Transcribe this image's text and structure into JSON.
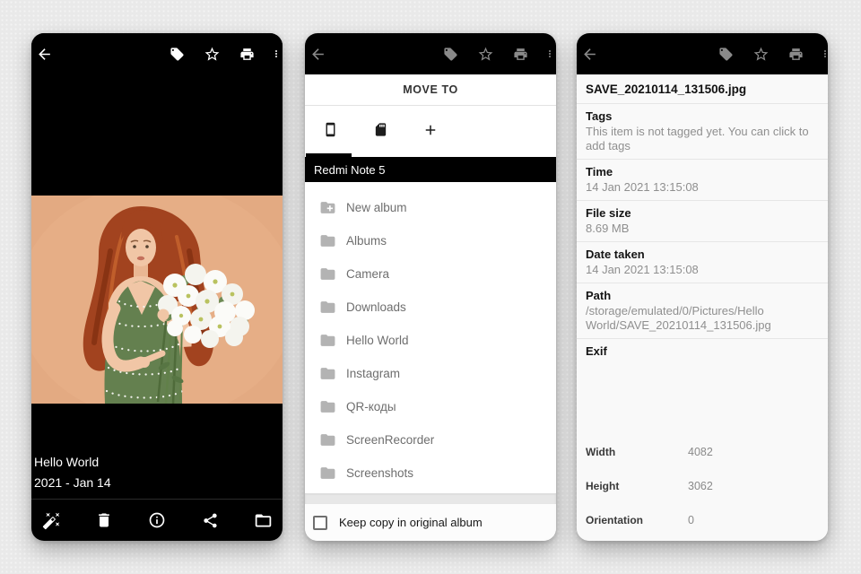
{
  "app": {
    "background_color": "#e9e9e9",
    "bar_color": "#000000",
    "icon_active_color": "#ffffff",
    "icon_dimmed_color": "#8a8a8a"
  },
  "icons": {
    "top_toolbar": [
      "back-arrow-icon",
      "tag-icon",
      "star-icon",
      "print-icon",
      "more-vert-icon"
    ],
    "bottom_toolbar": [
      "auto-fix-icon",
      "delete-icon",
      "info-icon",
      "share-icon",
      "folder-open-icon"
    ],
    "tabs": [
      "smartphone-icon",
      "sd-card-icon",
      "plus-icon"
    ],
    "list": [
      "folder-plus-icon",
      "folder-icon"
    ]
  },
  "left_phone": {
    "caption": {
      "album": "Hello World",
      "date": "2021 - Jan 14"
    },
    "photo": {
      "description": "Woman with long red hair holding a bouquet of white daisies on a peach background",
      "bg_color": "#e3aa82"
    }
  },
  "middle_phone": {
    "dialog": {
      "title": "MOVE TO",
      "device_name": "Redmi Note 5",
      "folders": [
        "New album",
        "Albums",
        "Camera",
        "Downloads",
        "Hello World",
        "Instagram",
        "QR-коды",
        "ScreenRecorder",
        "Screenshots"
      ],
      "footer": {
        "checkbox_checked": false,
        "checkbox_label": "Keep copy in original album"
      }
    }
  },
  "right_phone": {
    "properties": {
      "filename": "SAVE_20210114_131506.jpg",
      "sections": [
        {
          "label": "Tags",
          "value": "This item is not tagged yet. You can click to add tags"
        },
        {
          "label": "Time",
          "value": "14 Jan 2021 13:15:08"
        },
        {
          "label": "File size",
          "value": "8.69 MB"
        },
        {
          "label": "Date taken",
          "value": "14 Jan 2021 13:15:08"
        },
        {
          "label": "Path",
          "value": "/storage/emulated/0/Pictures/Hello World/SAVE_20210114_131506.jpg"
        }
      ],
      "exif_label": "Exif",
      "exif": [
        {
          "label": "Width",
          "value": "4082"
        },
        {
          "label": "Height",
          "value": "3062"
        },
        {
          "label": "Orientation",
          "value": "0"
        }
      ]
    }
  }
}
